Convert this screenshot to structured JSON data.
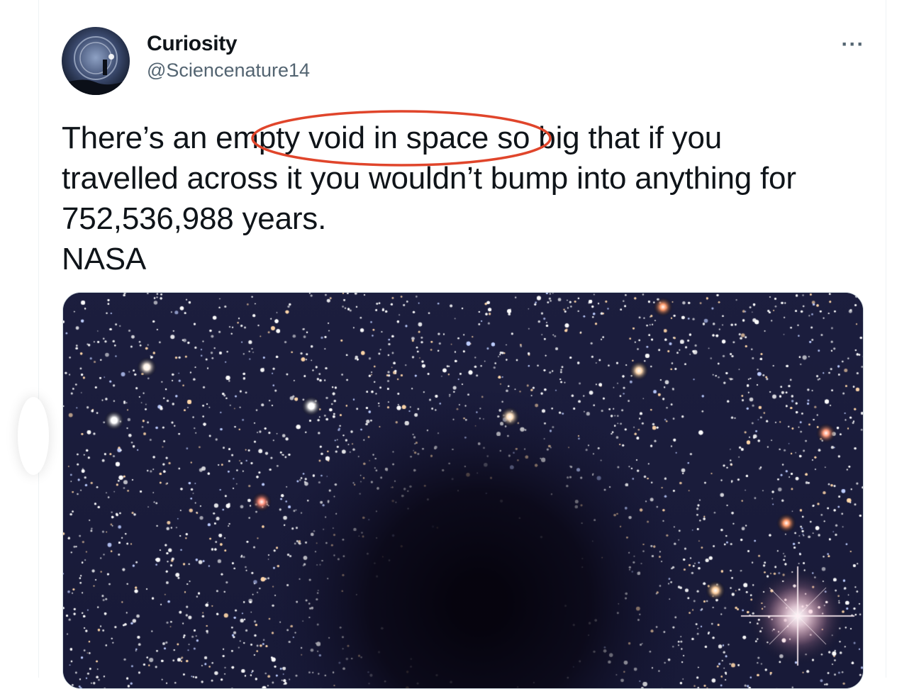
{
  "author": {
    "display_name": "Curiosity",
    "handle": "@Sciencenature14",
    "avatar_icon": "avatar-image"
  },
  "more_icon": "more-options-icon",
  "tweet": {
    "lines": [
      "There’s an empty void in space so big that if you",
      "travelled across it you wouldn’t bump into anything for",
      "752,536,988 years.",
      "NASA"
    ],
    "highlighted_phrase": "empty void in space"
  },
  "media": {
    "description_icon": "starfield-image"
  },
  "colors": {
    "text_primary": "#0f1419",
    "text_secondary": "#536471",
    "highlight_circle": "#e0452b",
    "media_border": "#cfd9de"
  }
}
